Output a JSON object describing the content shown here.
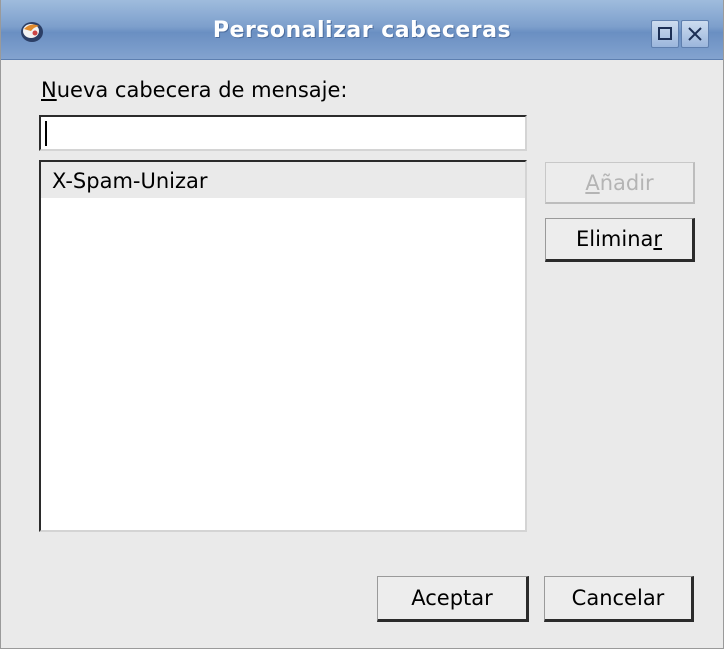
{
  "window": {
    "title": "Personalizar cabeceras",
    "titlebar_color": "#7d9fcc"
  },
  "icons": {
    "app": "app-logo-icon",
    "maximize": "maximize-icon",
    "close": "close-icon"
  },
  "form": {
    "label_mnemonic": "N",
    "label_rest": "ueva cabecera de mensaje:",
    "input_value": ""
  },
  "header_list": {
    "items": [
      "X-Spam-Unizar"
    ]
  },
  "buttons": {
    "add_mnemonic": "A",
    "add_rest": "ñadir",
    "add_enabled": false,
    "remove_prefix": "Elimina",
    "remove_mnemonic": "r",
    "ok": "Aceptar",
    "cancel": "Cancelar"
  }
}
